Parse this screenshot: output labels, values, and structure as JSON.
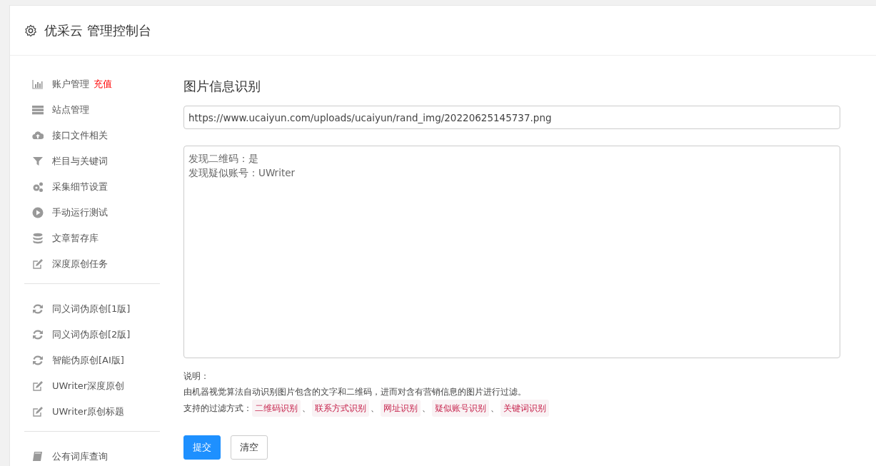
{
  "header": {
    "title": "优采云 管理控制台"
  },
  "sidebar": {
    "groups": [
      [
        {
          "kind": "bars",
          "label": "账户管理",
          "badge": "充值"
        },
        {
          "kind": "server",
          "label": "站点管理"
        },
        {
          "kind": "cloud",
          "label": "接口文件相关"
        },
        {
          "kind": "filter",
          "label": "栏目与关键词"
        },
        {
          "kind": "gears",
          "label": "采集细节设置"
        },
        {
          "kind": "play",
          "label": "手动运行测试"
        },
        {
          "kind": "database",
          "label": "文章暂存库"
        },
        {
          "kind": "edit",
          "label": "深度原创任务"
        }
      ],
      [
        {
          "kind": "refresh",
          "label": "同义词伪原创[1版]"
        },
        {
          "kind": "refresh",
          "label": "同义词伪原创[2版]"
        },
        {
          "kind": "refresh",
          "label": "智能伪原创[AI版]"
        },
        {
          "kind": "edit",
          "label": "UWriter深度原创"
        },
        {
          "kind": "edit",
          "label": "UWriter原创标题"
        }
      ],
      [
        {
          "kind": "book",
          "label": "公有词库查询"
        }
      ]
    ]
  },
  "main": {
    "title": "图片信息识别",
    "url_field": {
      "value": "https://www.ucaiyun.com/uploads/ucaiyun/rand_img/20220625145737.png"
    },
    "result_box": {
      "lines": [
        "发现二维码：是",
        "发现疑似账号：UWriter"
      ]
    },
    "notes": {
      "heading": "说明：",
      "description": "由机器视觉算法自动识别图片包含的文字和二维码，进而对含有营销信息的图片进行过滤。",
      "filters_label": "支持的过滤方式：",
      "separator": "、",
      "filters": [
        "二维码识别",
        "联系方式识别",
        "网址识别",
        "疑似账号识别",
        "关键词识别"
      ]
    },
    "buttons": [
      {
        "label": "提交",
        "kind": "primary"
      },
      {
        "label": "清空",
        "kind": "default"
      }
    ]
  }
}
